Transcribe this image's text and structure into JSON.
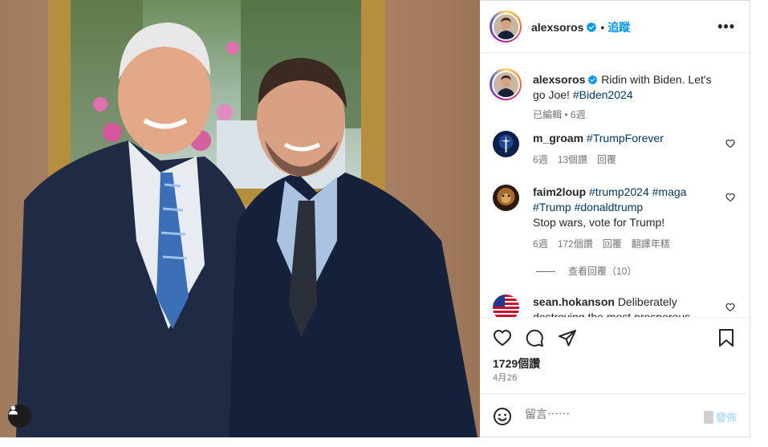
{
  "post": {
    "username": "alexsoros",
    "follow_label": "追蹤",
    "separator": "•",
    "more_label": "•••"
  },
  "caption": {
    "username": "alexsoros",
    "text": "Ridin with Biden. Let's go Joe! ",
    "hashtag": "#Biden2024",
    "edited": "已編輯",
    "meta_sep": "•",
    "time": "6週"
  },
  "comments": [
    {
      "username": "m_groam",
      "text_before": "",
      "hashtags": "#TrumpForever",
      "text_after": "",
      "time": "6週",
      "likes": "13個讚",
      "reply": "回覆",
      "translate": ""
    },
    {
      "username": "faim2loup",
      "text_before": "",
      "hashtags": "#trump2024 #maga #Trump #donaldtrump",
      "text_after": "Stop wars, vote for Trump!",
      "time": "6週",
      "likes": "172個讚",
      "reply": "回覆",
      "translate": "翻譯年糕"
    },
    {
      "username": "sean.hokanson",
      "text_before": "Deliberately",
      "hashtags": "",
      "text_after": "destroying the most prosperous",
      "time": "",
      "likes": "",
      "reply": "",
      "translate": ""
    }
  ],
  "view_replies": "查看回覆（10）",
  "stats": {
    "likes": "1729個讚",
    "date": "4月26"
  },
  "composer": {
    "placeholder": "留言⋯⋯",
    "post_label": "發佈"
  },
  "colors": {
    "accent": "#0095f6",
    "hashtag": "#00376b",
    "muted": "#737373",
    "verified": "#0095f6"
  },
  "icons": {
    "like": "heart-icon",
    "comment": "comment-icon",
    "share": "share-icon",
    "save": "bookmark-icon",
    "emoji": "emoji-icon",
    "tag": "user-tag-icon",
    "verified": "verified-badge-icon"
  }
}
